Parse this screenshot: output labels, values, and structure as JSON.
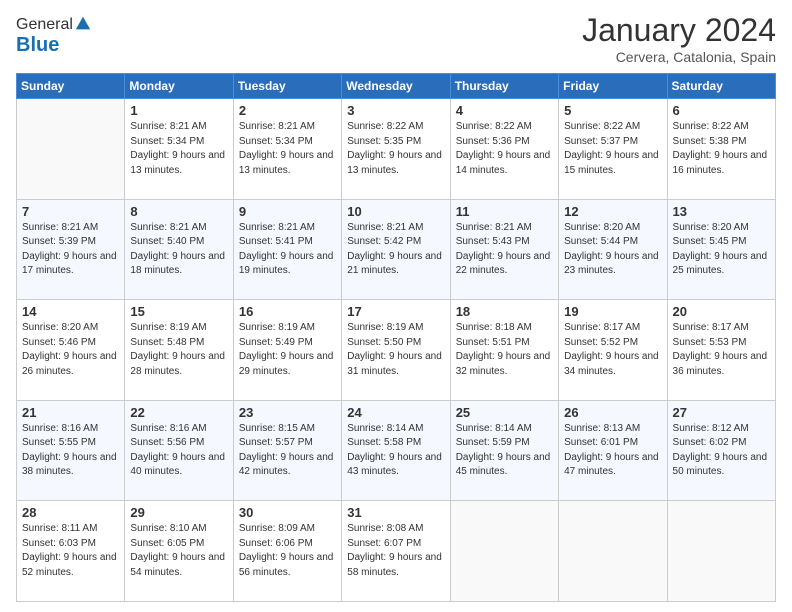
{
  "header": {
    "logo_general": "General",
    "logo_blue": "Blue",
    "month_title": "January 2024",
    "location": "Cervera, Catalonia, Spain"
  },
  "weekdays": [
    "Sunday",
    "Monday",
    "Tuesday",
    "Wednesday",
    "Thursday",
    "Friday",
    "Saturday"
  ],
  "weeks": [
    [
      {
        "day": "",
        "sunrise": "",
        "sunset": "",
        "daylight": ""
      },
      {
        "day": "1",
        "sunrise": "Sunrise: 8:21 AM",
        "sunset": "Sunset: 5:34 PM",
        "daylight": "Daylight: 9 hours and 13 minutes."
      },
      {
        "day": "2",
        "sunrise": "Sunrise: 8:21 AM",
        "sunset": "Sunset: 5:34 PM",
        "daylight": "Daylight: 9 hours and 13 minutes."
      },
      {
        "day": "3",
        "sunrise": "Sunrise: 8:22 AM",
        "sunset": "Sunset: 5:35 PM",
        "daylight": "Daylight: 9 hours and 13 minutes."
      },
      {
        "day": "4",
        "sunrise": "Sunrise: 8:22 AM",
        "sunset": "Sunset: 5:36 PM",
        "daylight": "Daylight: 9 hours and 14 minutes."
      },
      {
        "day": "5",
        "sunrise": "Sunrise: 8:22 AM",
        "sunset": "Sunset: 5:37 PM",
        "daylight": "Daylight: 9 hours and 15 minutes."
      },
      {
        "day": "6",
        "sunrise": "Sunrise: 8:22 AM",
        "sunset": "Sunset: 5:38 PM",
        "daylight": "Daylight: 9 hours and 16 minutes."
      }
    ],
    [
      {
        "day": "7",
        "sunrise": "Sunrise: 8:21 AM",
        "sunset": "Sunset: 5:39 PM",
        "daylight": "Daylight: 9 hours and 17 minutes."
      },
      {
        "day": "8",
        "sunrise": "Sunrise: 8:21 AM",
        "sunset": "Sunset: 5:40 PM",
        "daylight": "Daylight: 9 hours and 18 minutes."
      },
      {
        "day": "9",
        "sunrise": "Sunrise: 8:21 AM",
        "sunset": "Sunset: 5:41 PM",
        "daylight": "Daylight: 9 hours and 19 minutes."
      },
      {
        "day": "10",
        "sunrise": "Sunrise: 8:21 AM",
        "sunset": "Sunset: 5:42 PM",
        "daylight": "Daylight: 9 hours and 21 minutes."
      },
      {
        "day": "11",
        "sunrise": "Sunrise: 8:21 AM",
        "sunset": "Sunset: 5:43 PM",
        "daylight": "Daylight: 9 hours and 22 minutes."
      },
      {
        "day": "12",
        "sunrise": "Sunrise: 8:20 AM",
        "sunset": "Sunset: 5:44 PM",
        "daylight": "Daylight: 9 hours and 23 minutes."
      },
      {
        "day": "13",
        "sunrise": "Sunrise: 8:20 AM",
        "sunset": "Sunset: 5:45 PM",
        "daylight": "Daylight: 9 hours and 25 minutes."
      }
    ],
    [
      {
        "day": "14",
        "sunrise": "Sunrise: 8:20 AM",
        "sunset": "Sunset: 5:46 PM",
        "daylight": "Daylight: 9 hours and 26 minutes."
      },
      {
        "day": "15",
        "sunrise": "Sunrise: 8:19 AM",
        "sunset": "Sunset: 5:48 PM",
        "daylight": "Daylight: 9 hours and 28 minutes."
      },
      {
        "day": "16",
        "sunrise": "Sunrise: 8:19 AM",
        "sunset": "Sunset: 5:49 PM",
        "daylight": "Daylight: 9 hours and 29 minutes."
      },
      {
        "day": "17",
        "sunrise": "Sunrise: 8:19 AM",
        "sunset": "Sunset: 5:50 PM",
        "daylight": "Daylight: 9 hours and 31 minutes."
      },
      {
        "day": "18",
        "sunrise": "Sunrise: 8:18 AM",
        "sunset": "Sunset: 5:51 PM",
        "daylight": "Daylight: 9 hours and 32 minutes."
      },
      {
        "day": "19",
        "sunrise": "Sunrise: 8:17 AM",
        "sunset": "Sunset: 5:52 PM",
        "daylight": "Daylight: 9 hours and 34 minutes."
      },
      {
        "day": "20",
        "sunrise": "Sunrise: 8:17 AM",
        "sunset": "Sunset: 5:53 PM",
        "daylight": "Daylight: 9 hours and 36 minutes."
      }
    ],
    [
      {
        "day": "21",
        "sunrise": "Sunrise: 8:16 AM",
        "sunset": "Sunset: 5:55 PM",
        "daylight": "Daylight: 9 hours and 38 minutes."
      },
      {
        "day": "22",
        "sunrise": "Sunrise: 8:16 AM",
        "sunset": "Sunset: 5:56 PM",
        "daylight": "Daylight: 9 hours and 40 minutes."
      },
      {
        "day": "23",
        "sunrise": "Sunrise: 8:15 AM",
        "sunset": "Sunset: 5:57 PM",
        "daylight": "Daylight: 9 hours and 42 minutes."
      },
      {
        "day": "24",
        "sunrise": "Sunrise: 8:14 AM",
        "sunset": "Sunset: 5:58 PM",
        "daylight": "Daylight: 9 hours and 43 minutes."
      },
      {
        "day": "25",
        "sunrise": "Sunrise: 8:14 AM",
        "sunset": "Sunset: 5:59 PM",
        "daylight": "Daylight: 9 hours and 45 minutes."
      },
      {
        "day": "26",
        "sunrise": "Sunrise: 8:13 AM",
        "sunset": "Sunset: 6:01 PM",
        "daylight": "Daylight: 9 hours and 47 minutes."
      },
      {
        "day": "27",
        "sunrise": "Sunrise: 8:12 AM",
        "sunset": "Sunset: 6:02 PM",
        "daylight": "Daylight: 9 hours and 50 minutes."
      }
    ],
    [
      {
        "day": "28",
        "sunrise": "Sunrise: 8:11 AM",
        "sunset": "Sunset: 6:03 PM",
        "daylight": "Daylight: 9 hours and 52 minutes."
      },
      {
        "day": "29",
        "sunrise": "Sunrise: 8:10 AM",
        "sunset": "Sunset: 6:05 PM",
        "daylight": "Daylight: 9 hours and 54 minutes."
      },
      {
        "day": "30",
        "sunrise": "Sunrise: 8:09 AM",
        "sunset": "Sunset: 6:06 PM",
        "daylight": "Daylight: 9 hours and 56 minutes."
      },
      {
        "day": "31",
        "sunrise": "Sunrise: 8:08 AM",
        "sunset": "Sunset: 6:07 PM",
        "daylight": "Daylight: 9 hours and 58 minutes."
      },
      {
        "day": "",
        "sunrise": "",
        "sunset": "",
        "daylight": ""
      },
      {
        "day": "",
        "sunrise": "",
        "sunset": "",
        "daylight": ""
      },
      {
        "day": "",
        "sunrise": "",
        "sunset": "",
        "daylight": ""
      }
    ]
  ]
}
